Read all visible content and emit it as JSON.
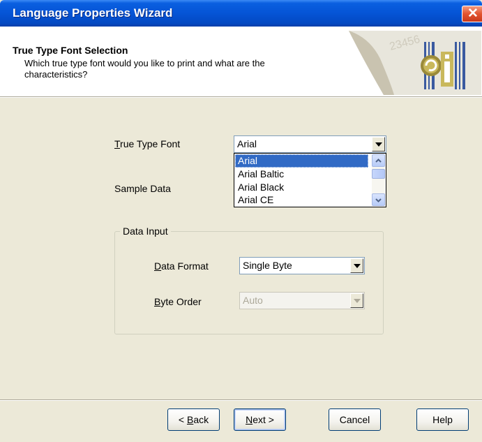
{
  "window": {
    "title": "Language Properties Wizard",
    "close_symbol": "✕"
  },
  "header": {
    "title": "True Type Font Selection",
    "subtitle": "Which true type font would you like to print and what are the characteristics?",
    "art_numbers": "23456"
  },
  "form": {
    "font_label_first": "T",
    "font_label_rest": "rue Type Font",
    "font_value": "Arial",
    "font_options": [
      "Arial",
      "Arial Baltic",
      "Arial Black",
      "Arial CE"
    ],
    "sample_label": "Sample Data"
  },
  "data_input": {
    "group_label": "Data Input",
    "format_label_first": "D",
    "format_label_rest": "ata Format",
    "format_value": "Single Byte",
    "order_label_first": "B",
    "order_label_rest": "yte Order",
    "order_value": "Auto"
  },
  "buttons": {
    "back_prefix": "< ",
    "back_first": "B",
    "back_rest": "ack",
    "next_first": "N",
    "next_rest": "ext >",
    "cancel": "Cancel",
    "help": "Help"
  },
  "icons": [
    "close-icon",
    "chevron-down-icon",
    "chevron-up-icon",
    "wizard-art-icon"
  ],
  "colors": {
    "titlebar": "#0554d6",
    "face": "#ece9d8",
    "selection": "#316ac5"
  }
}
